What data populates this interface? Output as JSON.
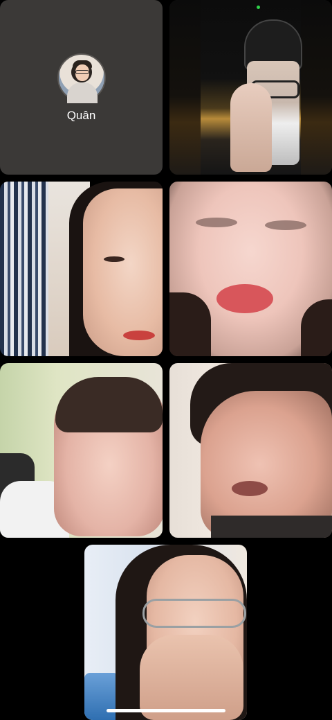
{
  "participants": [
    {
      "name": "Quân",
      "video_on": false
    },
    {
      "video_on": true
    },
    {
      "video_on": true
    },
    {
      "video_on": true
    },
    {
      "video_on": true
    },
    {
      "video_on": true
    },
    {
      "video_on": true
    }
  ],
  "colors": {
    "background": "#000000",
    "avatar_tile": "#3b3937",
    "active_indicator": "#2fd24a",
    "home_indicator": "#ffffff"
  }
}
